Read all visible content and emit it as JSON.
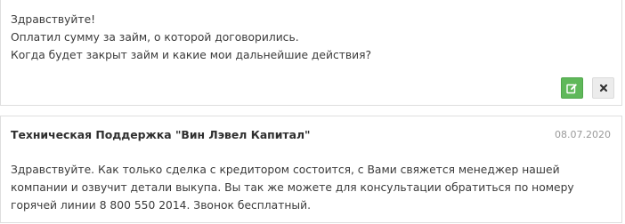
{
  "user_message": {
    "lines": [
      "Здравствуйте!",
      "Оплатил сумму за займ, о которой договорились.",
      "Когда будет закрыт займ и какие мои дальнейшие действия?"
    ],
    "actions": {
      "edit_icon": "edit-icon",
      "delete_icon": "close-icon"
    }
  },
  "support_message": {
    "author": "Техническая Поддержка \"Вин Лэвел Капитал\"",
    "date": "08.07.2020",
    "text": "Здравствуйте. Как только сделка с кредитором состоится, с Вами свяжется менеджер нашей компании и озвучит детали выкупа. Вы так же можете для консультации обратиться по номеру горячей линии 8 800 550 2014. Звонок бесплатный."
  },
  "colors": {
    "edit_button": "#5fb85a",
    "close_button": "#ececec",
    "border": "#dedede",
    "date_text": "#9a9a9a"
  }
}
